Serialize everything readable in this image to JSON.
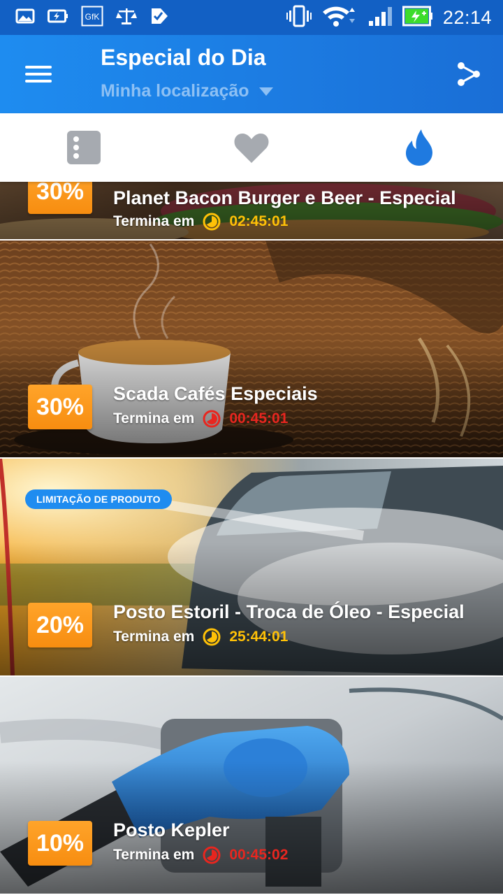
{
  "status_bar": {
    "time": "22:14",
    "left_icons": [
      "image-icon",
      "battery-saver-icon",
      "gfk-icon",
      "scale-icon",
      "check-tag-icon"
    ],
    "left_icon_label_gfk": "GfK",
    "right_icons": [
      "vibrate-icon",
      "wifi-icon",
      "signal-icon",
      "battery-charging-icon"
    ],
    "battery_color": "#3ddc2c"
  },
  "app_bar": {
    "title": "Especial do Dia",
    "location": "Minha localização",
    "menu_icon": "hamburger-menu-icon",
    "share_icon": "share-icon"
  },
  "tabs": [
    {
      "name": "list",
      "icon": "list-icon",
      "active": false
    },
    {
      "name": "favorites",
      "icon": "heart-icon",
      "active": false
    },
    {
      "name": "hot",
      "icon": "flame-icon",
      "active": true
    }
  ],
  "colors": {
    "primary": "#1a7ae0",
    "badge_orange": "#f7941d",
    "timer_yellow": "#ffc107",
    "timer_red": "#e8261f",
    "tab_inactive": "#a6aab0"
  },
  "feed": {
    "timer_label": "Termina em",
    "items": [
      {
        "discount": "30%",
        "title": "Planet Bacon Burger e Beer - Especial",
        "timer": "02:45:01",
        "timer_status": "normal",
        "limit_tag": "",
        "image": "burger-photo"
      },
      {
        "discount": "30%",
        "title": "Scada Cafés Especiais",
        "timer": "00:45:01",
        "timer_status": "urgent",
        "limit_tag": "",
        "image": "coffee-photo"
      },
      {
        "discount": "20%",
        "title": "Posto Estoril - Troca de Óleo - Especial",
        "timer": "25:44:01",
        "timer_status": "normal",
        "limit_tag": "LIMITAÇÃO DE PRODUTO",
        "image": "car-wash-photo"
      },
      {
        "discount": "10%",
        "title": "Posto Kepler",
        "timer": "00:45:02",
        "timer_status": "urgent",
        "limit_tag": "",
        "image": "fuel-pump-photo"
      }
    ]
  }
}
